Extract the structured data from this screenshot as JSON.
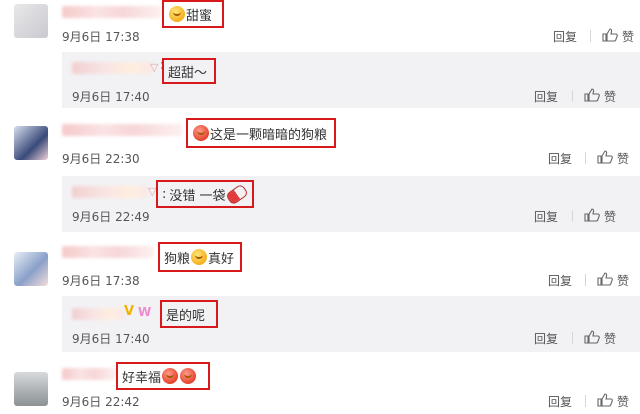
{
  "comments": [
    {
      "text": "甜蜜",
      "time": "9月6日 17:38"
    },
    {
      "text": "这是一颗暗暗的狗粮",
      "time": "9月6日 22:30"
    },
    {
      "text_before": "狗粮",
      "text_after": "真好",
      "time": "9月6日 17:38"
    },
    {
      "text": "好幸福",
      "time": "9月6日 22:42"
    }
  ],
  "replies": [
    {
      "text": "超甜～",
      "time": "9月6日 17:40"
    },
    {
      "text": "没错 一袋",
      "time": "9月6日 22:49"
    },
    {
      "text": "是的呢",
      "time": "9月6日 17:40"
    }
  ],
  "actions": {
    "reply": "回复",
    "like": "赞"
  },
  "reply_prefix": ":",
  "colors": {
    "highlight_box": "#d7191c",
    "reply_bg": "#f2f2f5",
    "text": "#333333",
    "meta": "#555555"
  },
  "icons": [
    "thumbs-up-icon",
    "emoji-icon",
    "pill-icon"
  ]
}
